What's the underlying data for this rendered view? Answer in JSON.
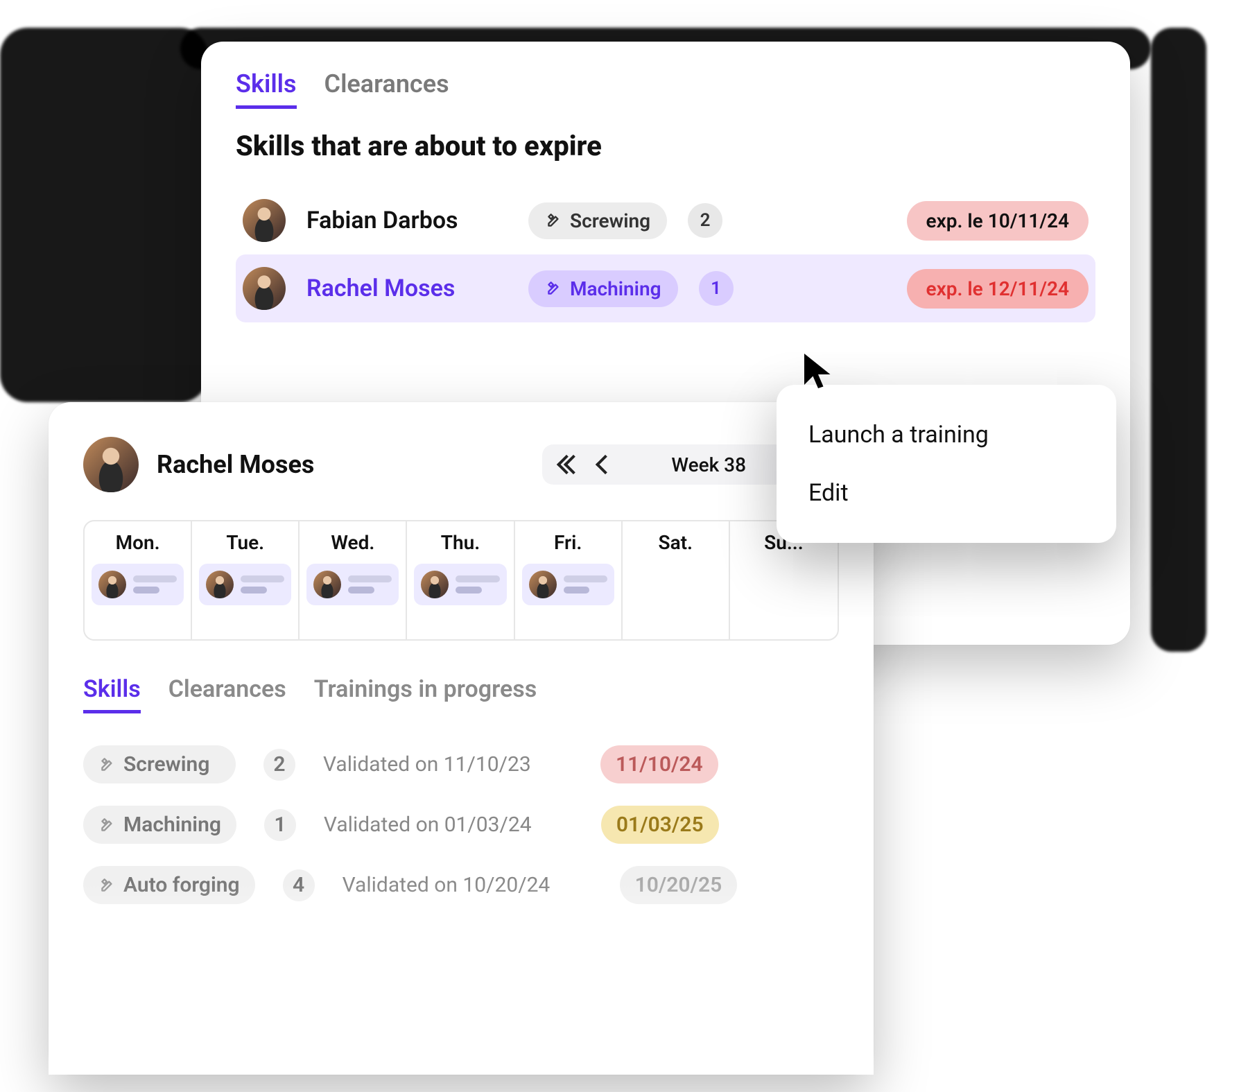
{
  "backCard": {
    "tabs": {
      "skills": "Skills",
      "clearances": "Clearances",
      "activeIndex": 0
    },
    "sectionTitle": "Skills that are about to expire",
    "rows": [
      {
        "name": "Fabian Darbos",
        "skill": "Screwing",
        "count": "2",
        "expiry": "exp. le 10/11/24",
        "highlighted": false
      },
      {
        "name": "Rachel Moses",
        "skill": "Machining",
        "count": "1",
        "expiry": "exp. le 12/11/24",
        "highlighted": true
      }
    ]
  },
  "contextMenu": {
    "items": {
      "launch": "Launch a training",
      "edit": "Edit"
    }
  },
  "frontCard": {
    "personName": "Rachel Moses",
    "weekLabel": "Week 38",
    "days": [
      "Mon.",
      "Tue.",
      "Wed.",
      "Thu.",
      "Fri.",
      "Sat.",
      "Su..."
    ],
    "daysWithEntry": [
      true,
      true,
      true,
      true,
      true,
      false,
      false
    ],
    "tabs": {
      "skills": "Skills",
      "clearances": "Clearances",
      "trainings": "Trainings in progress",
      "activeIndex": 0
    },
    "skillRows": [
      {
        "skill": "Screwing",
        "count": "2",
        "validated": "Validated on 11/10/23",
        "date": "11/10/24",
        "dateStyle": "pink"
      },
      {
        "skill": "Machining",
        "count": "1",
        "validated": "Validated on 01/03/24",
        "date": "01/03/25",
        "dateStyle": "yellow"
      },
      {
        "skill": "Auto forging",
        "count": "4",
        "validated": "Validated on 10/20/24",
        "date": "10/20/25",
        "dateStyle": "gray"
      }
    ]
  }
}
